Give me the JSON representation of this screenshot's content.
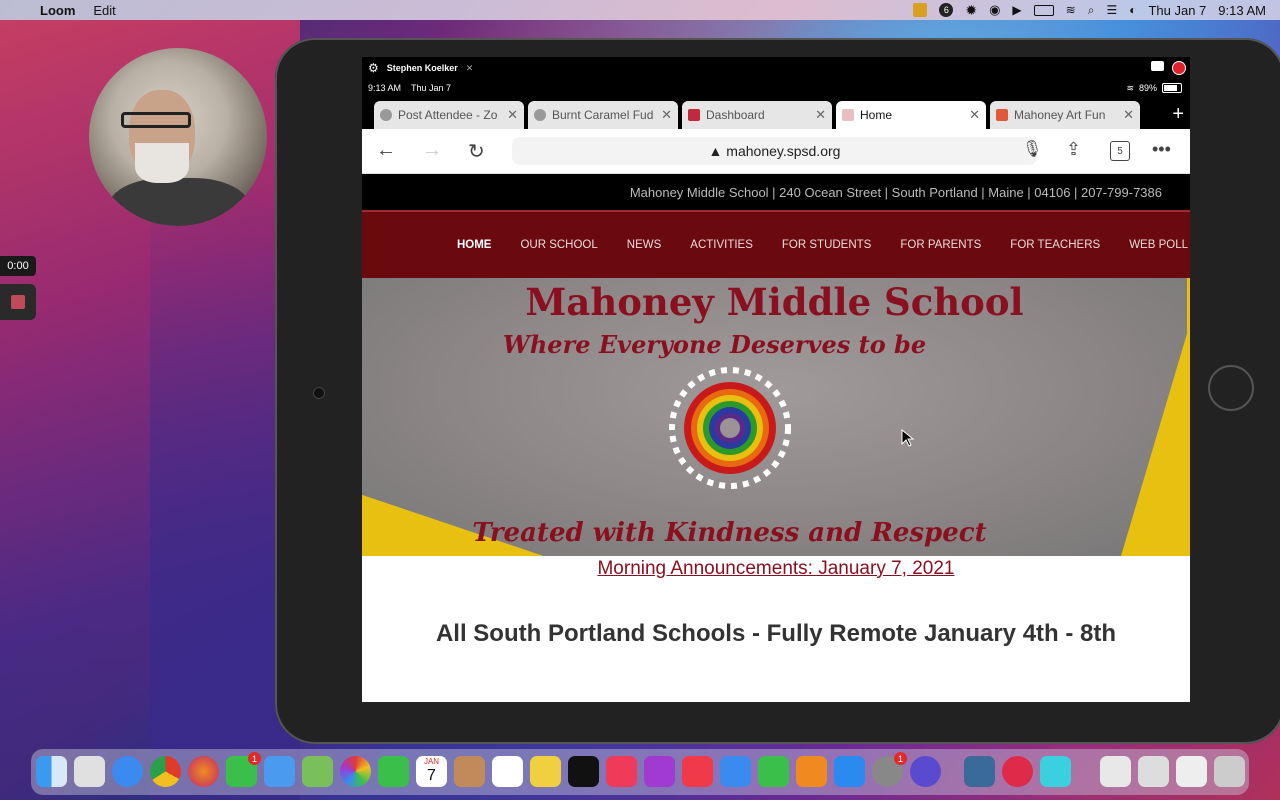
{
  "menubar": {
    "app_name": "Loom",
    "menu_items": [
      "Edit"
    ],
    "notification_count": "6",
    "clock_date": "Thu Jan 7",
    "clock_time": "9:13 AM"
  },
  "recorder": {
    "timer": "0:00"
  },
  "ipad": {
    "share_bar_user": "Stephen Koelker",
    "status_time": "9:13 AM",
    "status_date": "Thu Jan 7",
    "battery": "89%",
    "tabs": [
      {
        "label": "Post Attendee - Zo",
        "icon": "globe-icon"
      },
      {
        "label": "Burnt Caramel Fud",
        "icon": "globe-icon"
      },
      {
        "label": "Dashboard",
        "icon": "dashboard-favicon"
      },
      {
        "label": "Home",
        "icon": "school-favicon",
        "active": true
      },
      {
        "label": "Mahoney Art Fun",
        "icon": "art-favicon"
      }
    ],
    "url": "▲ mahoney.spsd.org",
    "tab_count": "5"
  },
  "site": {
    "contact": "Mahoney Middle School | 240 Ocean Street | South Portland | Maine | 04106 | 207-799-7386",
    "nav": [
      "HOME",
      "OUR SCHOOL",
      "NEWS",
      "ACTIVITIES",
      "FOR STUDENTS",
      "FOR PARENTS",
      "FOR TEACHERS",
      "WEB POLL"
    ],
    "hero_title": "Mahoney Middle School",
    "hero_subtitle": "Where Everyone Deserves to be",
    "hero_bottom": "Treated with Kindness and Respect",
    "announcement_link": "Morning Announcements: January 7, 2021",
    "headline": "All South Portland Schools - Fully Remote January 4th - 8th"
  },
  "colors": {
    "nav_bg": "#6a0a0e",
    "brand_red": "#8a1020"
  },
  "dock": {
    "calendar_month": "JAN",
    "calendar_day": "7",
    "mail_badge": "1",
    "sysprefs_badge": "1"
  }
}
